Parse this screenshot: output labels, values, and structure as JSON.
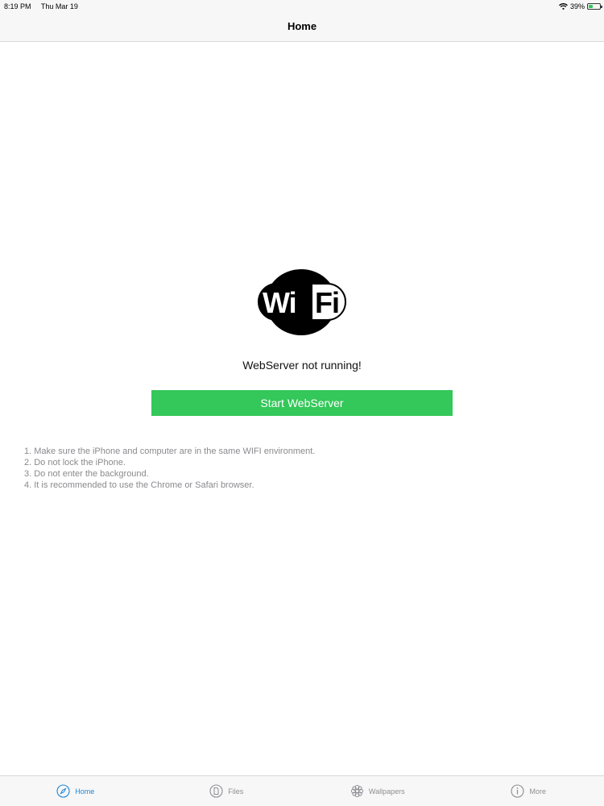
{
  "status_bar": {
    "time": "8:19 PM",
    "date": "Thu Mar 19",
    "battery": "39%",
    "battery_level": 0.39,
    "wifi_icon": "wifi-icon",
    "battery_icon": "battery-icon"
  },
  "nav": {
    "title": "Home"
  },
  "main": {
    "logo_icon": "wifi-logo",
    "logo_text": "WiFi",
    "status": "WebServer not running!",
    "start_button": "Start WebServer",
    "instructions": [
      "1. Make sure the iPhone and computer are in the same WIFI environment.",
      "2. Do not lock the iPhone.",
      "3. Do not enter the background.",
      "4. It is recommended to use the Chrome or Safari browser."
    ]
  },
  "tabs": [
    {
      "label": "Home",
      "icon": "compass-icon",
      "active": true
    },
    {
      "label": "Files",
      "icon": "document-icon",
      "active": false
    },
    {
      "label": "Wallpapers",
      "icon": "flower-icon",
      "active": false
    },
    {
      "label": "More",
      "icon": "info-icon",
      "active": false
    }
  ],
  "colors": {
    "accent": "#1d87d8",
    "button": "#34c759",
    "battery": "#34c759"
  }
}
